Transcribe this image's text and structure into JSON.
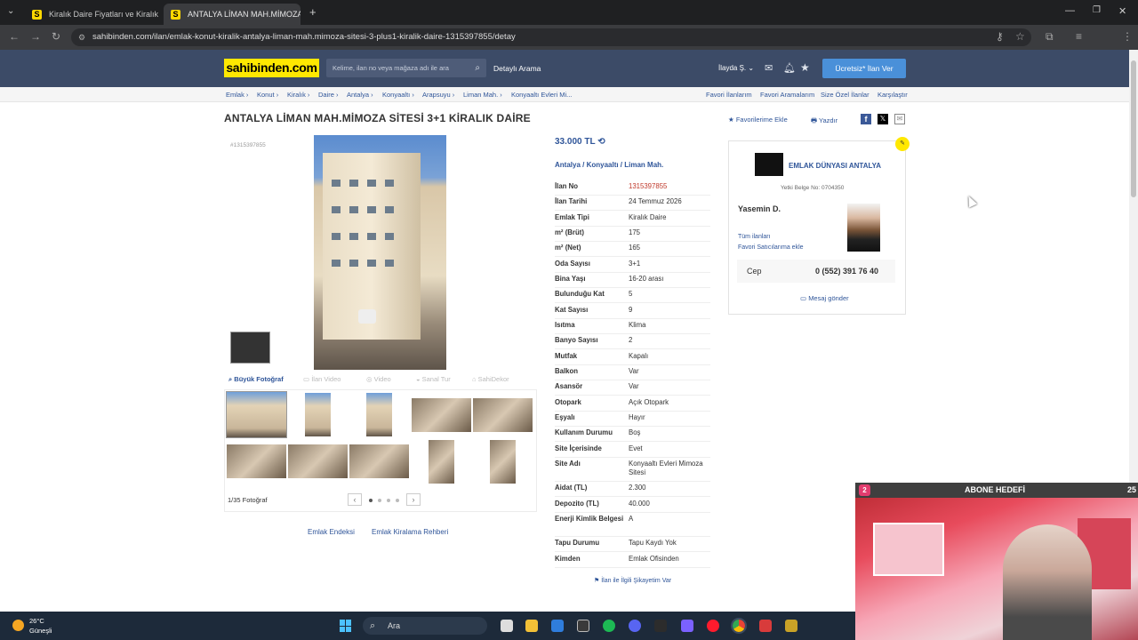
{
  "browser": {
    "tabs": [
      {
        "label": "Kiralık Daire Fiyatları ve Kiralık D",
        "favicon": "S"
      },
      {
        "label": "ANTALYA LİMAN MAH.MİMOZA S",
        "favicon": "S"
      }
    ],
    "url": "sahibinden.com/ilan/emlak-konut-kiralik-antalya-liman-mah.mimoza-sitesi-3-plus1-kiralik-daire-1315397855/detay"
  },
  "site": {
    "logo": "sahibinden.com",
    "search_placeholder": "Kelime, ilan no veya mağaza adı ile ara",
    "detailed_search": "Detaylı Arama",
    "user": "İlayda Ş.",
    "post_ad": "Ücretsiz* İlan Ver"
  },
  "breadcrumb": [
    "Emlak",
    "Konut",
    "Kiralık",
    "Daire",
    "Antalya",
    "Konyaaltı",
    "Arapsuyu",
    "Liman Mah.",
    "Konyaaltı Evleri Mi..."
  ],
  "top_links": [
    "Favori İlanlarım",
    "Favori Aramalarım",
    "Size Özel İlanlar",
    "Karşılaştır"
  ],
  "listing": {
    "title": "ANTALYA LİMAN MAH.MİMOZA SİTESİ 3+1 KİRALIK DAİRE",
    "add_favorite": "Favorilerime Ekle",
    "print": "Yazdır",
    "ad_no_small": "#1315397855",
    "price": "33.000 TL",
    "location": "Antalya  /  Konyaaltı  /  Liman Mah.",
    "details": [
      {
        "key": "İlan No",
        "value": "1315397855"
      },
      {
        "key": "İlan Tarihi",
        "value": "24 Temmuz 2026"
      },
      {
        "key": "Emlak Tipi",
        "value": "Kiralık Daire"
      },
      {
        "key": "m² (Brüt)",
        "value": "175"
      },
      {
        "key": "m² (Net)",
        "value": "165"
      },
      {
        "key": "Oda Sayısı",
        "value": "3+1"
      },
      {
        "key": "Bina Yaşı",
        "value": "16-20 arası"
      },
      {
        "key": "Bulunduğu Kat",
        "value": "5"
      },
      {
        "key": "Kat Sayısı",
        "value": "9"
      },
      {
        "key": "Isıtma",
        "value": "Klima"
      },
      {
        "key": "Banyo Sayısı",
        "value": "2"
      },
      {
        "key": "Mutfak",
        "value": "Kapalı"
      },
      {
        "key": "Balkon",
        "value": "Var"
      },
      {
        "key": "Asansör",
        "value": "Var"
      },
      {
        "key": "Otopark",
        "value": "Açık Otopark"
      },
      {
        "key": "Eşyalı",
        "value": "Hayır"
      },
      {
        "key": "Kullanım Durumu",
        "value": "Boş"
      },
      {
        "key": "Site İçerisinde",
        "value": "Evet"
      },
      {
        "key": "Site Adı",
        "value": "Konyaaltı Evleri Mimoza Sitesi"
      },
      {
        "key": "Aidat (TL)",
        "value": "2.300"
      },
      {
        "key": "Depozito (TL)",
        "value": "40.000"
      },
      {
        "key": "Enerji Kimlik Belgesi",
        "value": "A"
      },
      {
        "key": "Tapu Durumu",
        "value": "Tapu Kaydı Yok"
      },
      {
        "key": "Kimden",
        "value": "Emlak Ofisinden"
      }
    ],
    "complaint": "İlan ile İlgili Şikayetim Var"
  },
  "photos": {
    "tabs": [
      "Büyük Fotoğraf",
      "İlan Video",
      "Video",
      "Sanal Tur",
      "SahiDekor"
    ],
    "count": "1/35 Fotoğraf",
    "bottom_links": [
      "Emlak Endeksi",
      "Emlak Kiralama Rehberi"
    ]
  },
  "seller": {
    "agency": "EMLAK DÜNYASI ANTALYA",
    "license": "Yetki Belge No:  0704350",
    "name": "Yasemin D.",
    "all_ads": "Tüm ilanları",
    "add_fav": "Favori Satıcılarıma ekle",
    "phone_label": "Cep",
    "phone": "0 (552) 391 76 40",
    "message": "Mesaj gönder"
  },
  "overlay": {
    "abone_count": "2",
    "abone_title": "ABONE HEDEFİ",
    "abone_goal": "25"
  },
  "taskbar": {
    "temp": "26°C",
    "weather": "Güneşli",
    "search": "Ara"
  }
}
